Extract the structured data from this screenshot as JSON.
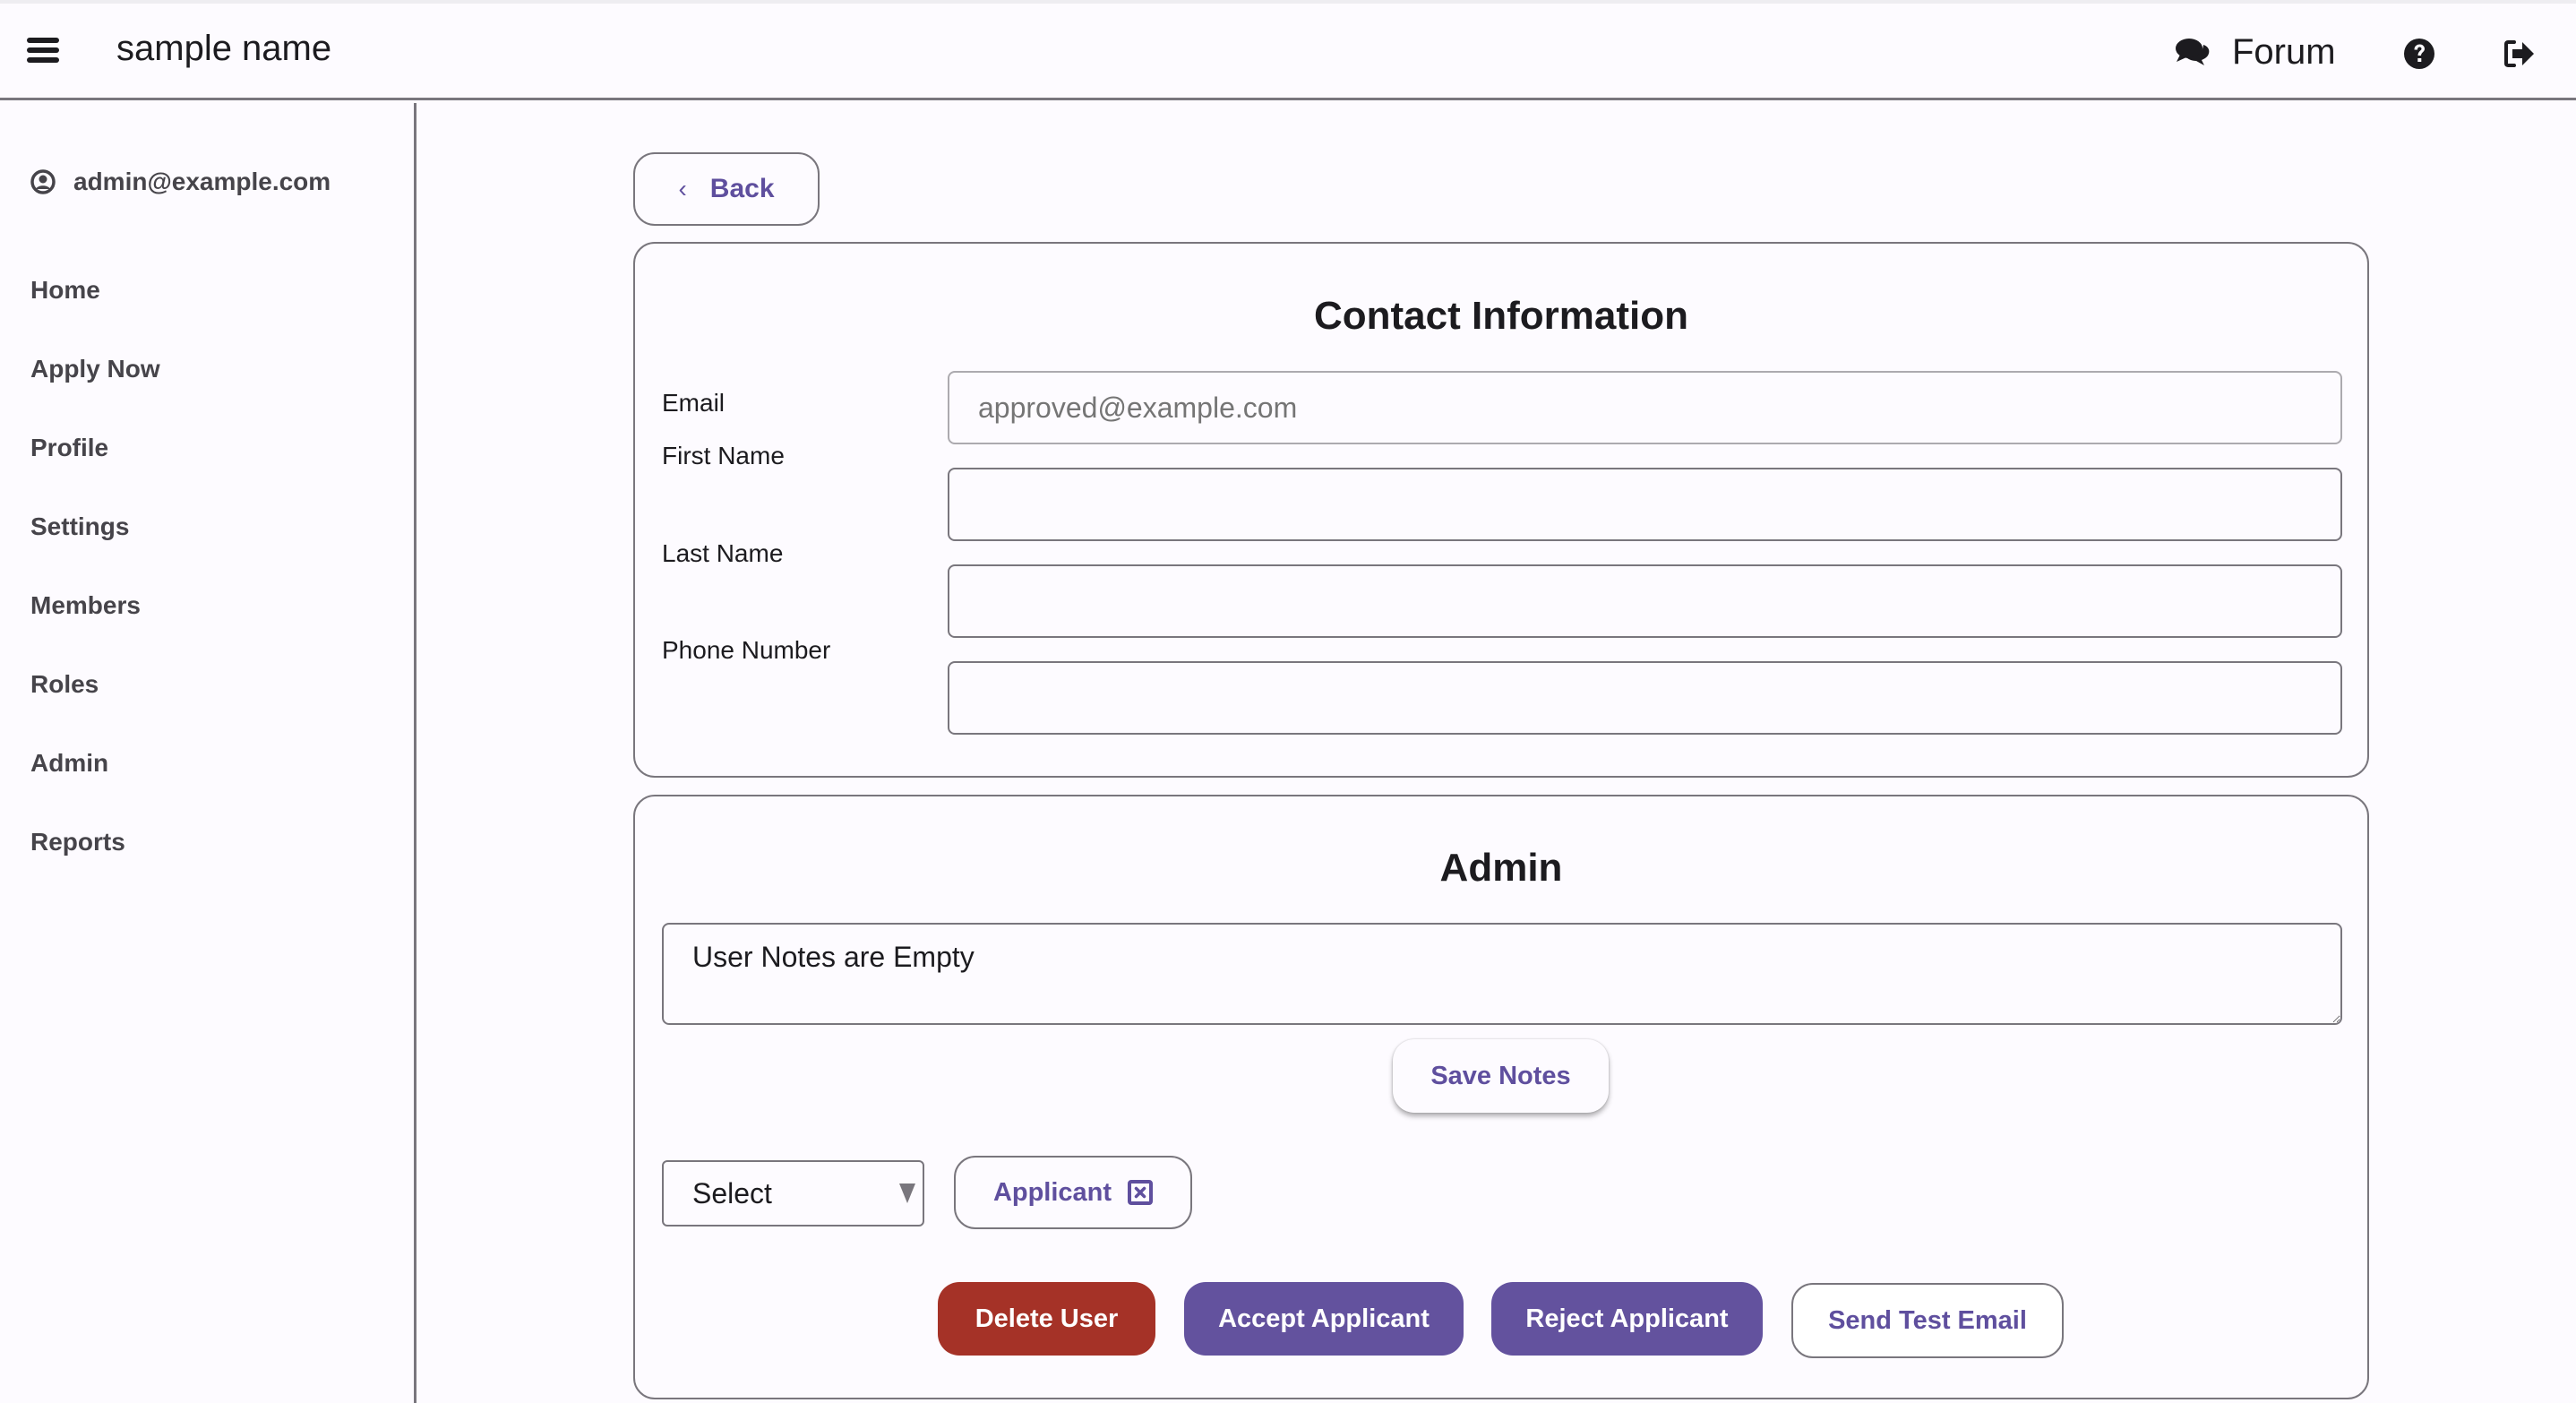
{
  "header": {
    "app_title": "sample name",
    "forum_label": "Forum",
    "icons": {
      "menu": "hamburger-menu-icon",
      "forum": "comments-icon",
      "help": "question-circle-icon",
      "logout": "sign-out-icon"
    }
  },
  "sidebar": {
    "user_email": "admin@example.com",
    "user_icon": "user-circle-icon",
    "items": [
      {
        "label": "Home"
      },
      {
        "label": "Apply Now"
      },
      {
        "label": "Profile"
      },
      {
        "label": "Settings"
      },
      {
        "label": "Members"
      },
      {
        "label": "Roles"
      },
      {
        "label": "Admin"
      },
      {
        "label": "Reports"
      }
    ]
  },
  "back_button": {
    "label": "Back",
    "icon": "chevron-left-icon"
  },
  "contact": {
    "title": "Contact Information",
    "fields": [
      {
        "label": "Email",
        "value": "",
        "placeholder": "approved@example.com",
        "disabled": true
      },
      {
        "label": "First Name",
        "value": "",
        "placeholder": ""
      },
      {
        "label": "Last Name",
        "value": "",
        "placeholder": ""
      },
      {
        "label": "Phone Number",
        "value": "",
        "placeholder": ""
      }
    ]
  },
  "admin": {
    "title": "Admin",
    "notes_value": "User Notes are Empty",
    "save_notes_label": "Save Notes",
    "role_select": {
      "selected": "Select"
    },
    "role_chip": {
      "label": "Applicant",
      "icon": "remove-square-icon"
    },
    "actions": {
      "delete_user": "Delete User",
      "accept_applicant": "Accept Applicant",
      "reject_applicant": "Reject Applicant",
      "send_test_email": "Send Test Email"
    }
  },
  "colors": {
    "primary": "#63529e",
    "primary_text": "#5f4f9e",
    "danger": "#a53227",
    "outline": "#79767d",
    "background": "#fdfbff"
  }
}
